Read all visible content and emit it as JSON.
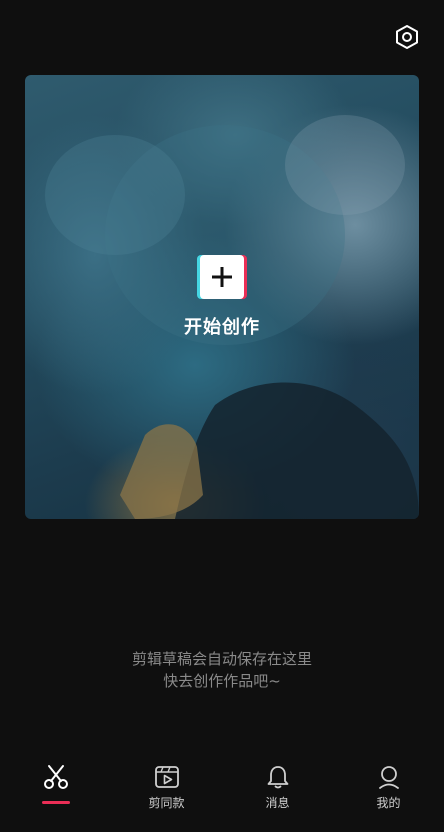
{
  "header": {
    "settings_icon": "settings-hexagon-icon"
  },
  "hero": {
    "cta_label": "开始创作",
    "plus_icon": "plus-icon"
  },
  "empty_state": {
    "line1": "剪辑草稿会自动保存在这里",
    "line2": "快去创作作品吧~"
  },
  "bottom_nav": {
    "items": [
      {
        "label": "",
        "icon": "scissors-icon",
        "active": true
      },
      {
        "label": "剪同款",
        "icon": "template-play-icon",
        "active": false
      },
      {
        "label": "消息",
        "icon": "bell-icon",
        "active": false
      },
      {
        "label": "我的",
        "icon": "profile-icon",
        "active": false
      }
    ]
  },
  "colors": {
    "background": "#0f0f0f",
    "accent": "#ea2e56",
    "accent_cyan": "#45d6e3",
    "hint_text": "#8a8a8a"
  }
}
